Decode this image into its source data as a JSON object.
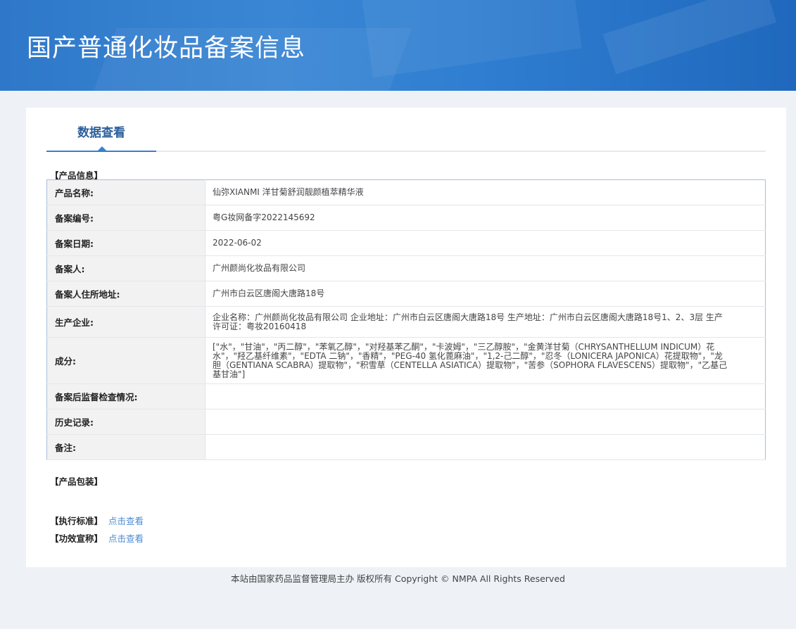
{
  "header": {
    "title": "国产普通化妆品备案信息"
  },
  "tabs": [
    {
      "label": "数据查看"
    }
  ],
  "product_info": {
    "section_title": "【产品信息】",
    "rows": [
      {
        "label": "产品名称:",
        "value": "仙弥XIANMI 洋甘菊舒润靓颜植萃精华液"
      },
      {
        "label": "备案编号:",
        "value": "粤G妆网备字2022145692"
      },
      {
        "label": "备案日期:",
        "value": "2022-06-02"
      },
      {
        "label": "备案人:",
        "value": "广州颜尚化妆品有限公司"
      },
      {
        "label": "备案人住所地址:",
        "value": "广州市白云区唐阁大唐路18号"
      },
      {
        "label": "生产企业:",
        "value": "企业名称：广州颜尚化妆品有限公司 企业地址：广州市白云区唐阁大唐路18号 生产地址：广州市白云区唐阁大唐路18号1、2、3层 生产许可证：粤妆20160418"
      },
      {
        "label": "成分:",
        "value": "[\"水\"，\"甘油\"，\"丙二醇\"，\"苯氧乙醇\"，\"对羟基苯乙酮\"，\"卡波姆\"，\"三乙醇胺\"，\"金黄洋甘菊（CHRYSANTHELLUM INDICUM）花水\"，\"羟乙基纤维素\"，\"EDTA 二钠\"，\"香精\"，\"PEG-40 氢化蓖麻油\"，\"1,2-己二醇\"，\"忍冬（LONICERA JAPONICA）花提取物\"，\"龙胆（GENTIANA SCABRA）提取物\"，\"积雪草（CENTELLA ASIATICA）提取物\"，\"苦参（SOPHORA FLAVESCENS）提取物\"，\"乙基己基甘油\"]"
      },
      {
        "label": "备案后监督检查情况:",
        "value": ""
      },
      {
        "label": "历史记录:",
        "value": ""
      },
      {
        "label": "备注:",
        "value": ""
      }
    ]
  },
  "packaging": {
    "section_title": "【产品包装】"
  },
  "standard": {
    "section_title": "【执行标准】",
    "link": "点击查看"
  },
  "efficacy": {
    "section_title": "【功效宣称】",
    "link": "点击查看"
  },
  "footer": {
    "text": "本站由国家药品监督管理局主办 版权所有 Copyright © NMPA All Rights Reserved"
  }
}
